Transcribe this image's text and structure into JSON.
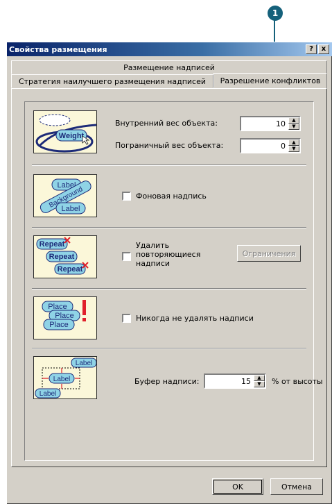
{
  "callout": {
    "number": "1"
  },
  "window": {
    "title": "Свойства размещения",
    "help_label": "?",
    "close_label": "x"
  },
  "tabs": {
    "row1": "Размещение надписей",
    "row2_left": "Стратегия наилучшего размещения надписей",
    "row2_active": "Разрешение конфликтов"
  },
  "weights": {
    "illus_text": "Weight",
    "internal_label": "Внутренний вес объекта:",
    "internal_value": "10",
    "border_label": "Пограничный вес объекта:",
    "border_value": "0"
  },
  "background": {
    "illus_label_top": "Label",
    "illus_background": "Background",
    "illus_label_bottom": "Label",
    "checkbox_label": "Фоновая надпись"
  },
  "repeat": {
    "illus_word": "Repeat",
    "checkbox_label_lines": [
      "Удалить",
      "повторяющиеся",
      "надписи"
    ],
    "limits_button": "Ограничения"
  },
  "never_remove": {
    "illus_word": "Place",
    "checkbox_label": "Никогда не удалять надписи"
  },
  "buffer": {
    "illus_word": "Label",
    "label": "Буфер надписи:",
    "value": "15",
    "unit": "% от высоты"
  },
  "footer": {
    "ok_label": "OK",
    "cancel_label": "Отмена"
  },
  "colors": {
    "title_start": "#0a246a",
    "title_end": "#a6caf0",
    "callout": "#15617b",
    "illus_bg": "#fbf7d9",
    "illus_label": "#8fd3e6",
    "illus_outline": "#1c2a78",
    "red_mark": "#e0202a"
  }
}
